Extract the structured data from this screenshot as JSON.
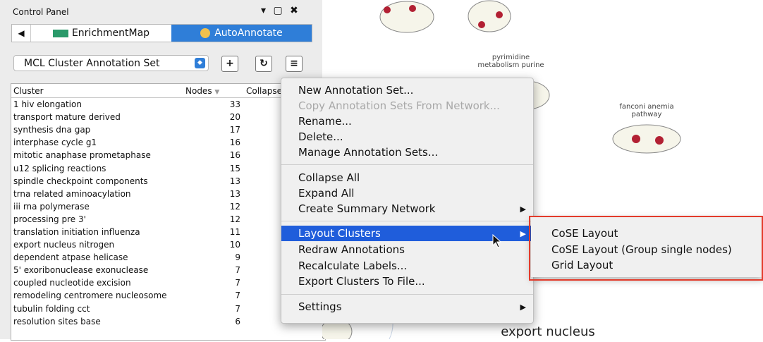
{
  "panel": {
    "title": "Control Panel",
    "controls": {
      "dropdown": "▾",
      "float": "▢",
      "close": "✖"
    },
    "back": "◀",
    "tabs": [
      {
        "label": "EnrichmentMap",
        "active": false
      },
      {
        "label": "AutoAnnotate",
        "active": true
      }
    ],
    "annotation_set": "MCL Cluster Annotation Set",
    "tool_buttons": {
      "add": "+",
      "refresh": "↻",
      "menu": "≡"
    },
    "table": {
      "headers": {
        "cluster": "Cluster",
        "nodes": "Nodes",
        "collapse": "Collapse"
      },
      "rows": [
        {
          "cluster": "1 hiv elongation",
          "nodes": "33"
        },
        {
          "cluster": "transport mature derived",
          "nodes": "20"
        },
        {
          "cluster": "synthesis dna gap",
          "nodes": "17"
        },
        {
          "cluster": "interphase cycle g1",
          "nodes": "16"
        },
        {
          "cluster": "mitotic anaphase prometaphase",
          "nodes": "16"
        },
        {
          "cluster": "u12 splicing reactions",
          "nodes": "15"
        },
        {
          "cluster": "spindle checkpoint components",
          "nodes": "13"
        },
        {
          "cluster": "trna related aminoacylation",
          "nodes": "13"
        },
        {
          "cluster": "iii rna polymerase",
          "nodes": "12"
        },
        {
          "cluster": "processing pre 3'",
          "nodes": "12"
        },
        {
          "cluster": "translation initiation influenza",
          "nodes": "11"
        },
        {
          "cluster": "export nucleus nitrogen",
          "nodes": "10"
        },
        {
          "cluster": "dependent atpase helicase",
          "nodes": "9"
        },
        {
          "cluster": "5' exoribonuclease exonuclease",
          "nodes": "7"
        },
        {
          "cluster": "coupled nucleotide excision",
          "nodes": "7"
        },
        {
          "cluster": "remodeling centromere nucleosome",
          "nodes": "7"
        },
        {
          "cluster": "tubulin folding cct",
          "nodes": "7"
        },
        {
          "cluster": "resolution sites base",
          "nodes": "6"
        }
      ]
    }
  },
  "network": {
    "labels": {
      "pyrimidine_1": "pyrimidine",
      "pyrimidine_2": "metabolism purine",
      "fanconi_1": "fanconi anemia",
      "fanconi_2": "pathway",
      "export": "export nucleus"
    }
  },
  "context_menu": {
    "new_set": "New Annotation Set...",
    "copy_sets": "Copy Annotation Sets From Network...",
    "rename": "Rename...",
    "delete": "Delete...",
    "manage": "Manage Annotation Sets...",
    "collapse_all": "Collapse All",
    "expand_all": "Expand All",
    "summary": "Create Summary Network",
    "layout": "Layout Clusters",
    "redraw": "Redraw Annotations",
    "recalc": "Recalculate Labels...",
    "export": "Export Clusters To File...",
    "settings": "Settings",
    "submenu_arrow": "▶"
  },
  "layout_submenu": {
    "cose": "CoSE Layout",
    "cose_group": "CoSE Layout (Group single nodes)",
    "grid": "Grid Layout"
  },
  "colors": {
    "accent": "#1f5ddb",
    "tab_active": "#2f7ed8",
    "highlight_box": "#e33b2b",
    "node": "#b22033"
  }
}
